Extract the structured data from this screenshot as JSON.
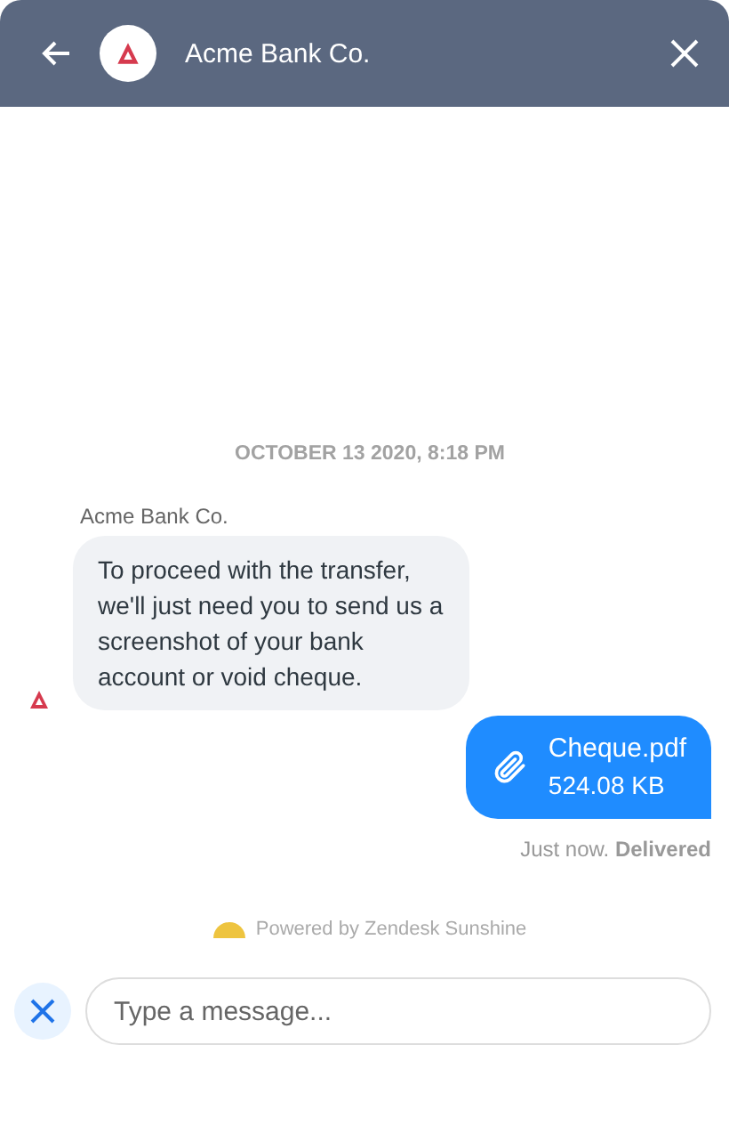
{
  "header": {
    "title": "Acme Bank Co."
  },
  "conversation": {
    "timestamp": "OCTOBER 13 2020, 8:18 PM",
    "messages": [
      {
        "kind": "text",
        "outgoing": false,
        "sender": "Acme Bank Co.",
        "text": "To proceed with the transfer, we'll just need you to send us a screenshot of your bank account or void cheque."
      },
      {
        "kind": "file",
        "outgoing": true,
        "file_name": "Cheque.pdf",
        "file_size": "524.08 KB",
        "status": "Just now. **Delivered**"
      }
    ]
  },
  "footer": {
    "powered_by": "Powered by Zendesk Sunshine"
  },
  "composer": {
    "placeholder": "Type a message..."
  }
}
